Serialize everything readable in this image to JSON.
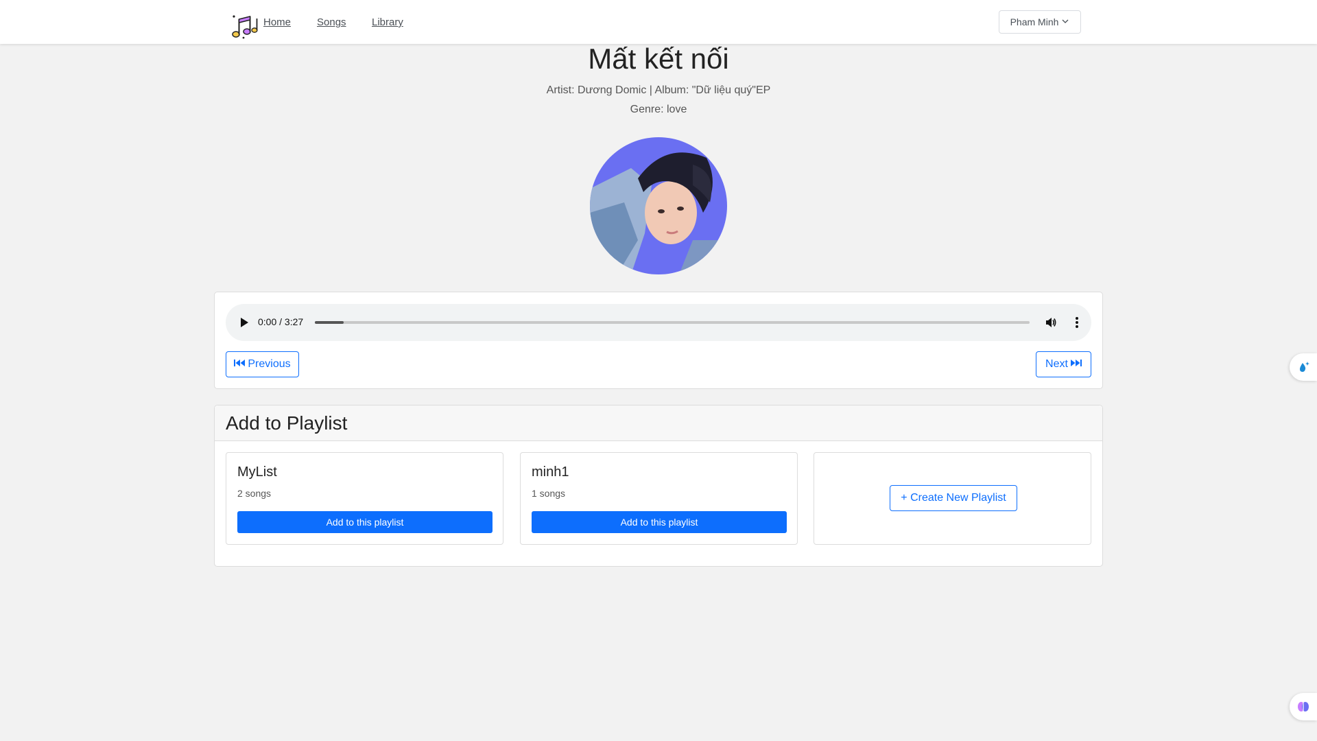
{
  "nav": {
    "links": [
      "Home",
      "Songs",
      "Library"
    ],
    "user_menu_label": "Pham Minh"
  },
  "song": {
    "title": "Mất kết nối",
    "artist_album": "Artist: Dương Domic | Album: \"Dữ liệu quý\"EP",
    "genre": "Genre: love"
  },
  "player": {
    "time": "0:00 / 3:27",
    "progress_fraction": 0.04,
    "previous_label": "Previous",
    "next_label": "Next"
  },
  "playlist_section": {
    "title": "Add to Playlist",
    "playlists": [
      {
        "name": "MyList",
        "count": "2 songs",
        "button": "Add to this playlist"
      },
      {
        "name": "minh1",
        "count": "1 songs",
        "button": "Add to this playlist"
      }
    ],
    "create_label": "+ Create New Playlist"
  },
  "colors": {
    "accent": "#0d6efd",
    "cover_background": "#6a6ff2"
  }
}
